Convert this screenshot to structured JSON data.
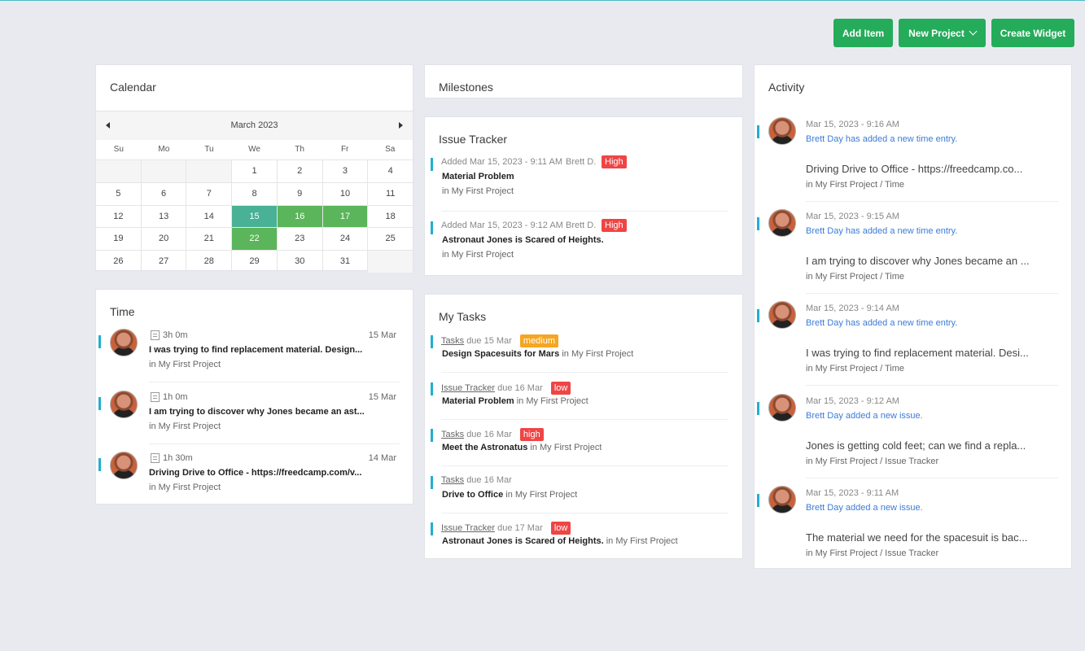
{
  "toolbar": {
    "add_item": "Add Item",
    "new_project": "New Project",
    "create_widget": "Create Widget"
  },
  "calendar": {
    "title": "Calendar",
    "month": "March 2023",
    "weekdays": [
      "Su",
      "Mo",
      "Tu",
      "We",
      "Th",
      "Fr",
      "Sa"
    ],
    "weeks": [
      [
        "",
        "",
        "",
        "1",
        "2",
        "3",
        "4"
      ],
      [
        "5",
        "6",
        "7",
        "8",
        "9",
        "10",
        "11"
      ],
      [
        "12",
        "13",
        "14",
        "15",
        "16",
        "17",
        "18"
      ],
      [
        "19",
        "20",
        "21",
        "22",
        "23",
        "24",
        "25"
      ],
      [
        "26",
        "27",
        "28",
        "29",
        "30",
        "31",
        ""
      ]
    ],
    "today": "15",
    "event_days": [
      "16",
      "17",
      "22"
    ]
  },
  "time": {
    "title": "Time",
    "entries": [
      {
        "duration": "3h 0m",
        "date": "15 Mar",
        "text": "I was trying to find replacement material. Design...",
        "project": "in My First Project"
      },
      {
        "duration": "1h 0m",
        "date": "15 Mar",
        "text": "I am trying to discover why Jones became an ast...",
        "project": "in My First Project"
      },
      {
        "duration": "1h 30m",
        "date": "14 Mar",
        "text": "Driving Drive to Office - https://freedcamp.com/v...",
        "project": "in My First Project"
      }
    ]
  },
  "milestones": {
    "title": "Milestones"
  },
  "issue_tracker": {
    "title": "Issue Tracker",
    "issues": [
      {
        "meta": "Added Mar 15, 2023 - 9:11 AM",
        "author": "Brett D.",
        "priority": "High",
        "title": "Material Problem",
        "project": "in My First Project"
      },
      {
        "meta": "Added Mar 15, 2023 - 9:12 AM",
        "author": "Brett D.",
        "priority": "High",
        "title": "Astronaut Jones is Scared of Heights.",
        "project": "in My First Project"
      }
    ]
  },
  "tasks": {
    "title": "My Tasks",
    "items": [
      {
        "app": "Tasks",
        "due": "due 15 Mar",
        "priority": "medium",
        "title": "Design Spacesuits for Mars",
        "project": "in My First Project"
      },
      {
        "app": "Issue Tracker",
        "due": "due 16 Mar",
        "priority": "low",
        "title": "Material Problem",
        "project": "in My First Project"
      },
      {
        "app": "Tasks",
        "due": "due 16 Mar",
        "priority": "high",
        "title": "Meet the Astronatus",
        "project": "in My First Project"
      },
      {
        "app": "Tasks",
        "due": "due 16 Mar",
        "priority": "",
        "title": "Drive to Office",
        "project": "in My First Project"
      },
      {
        "app": "Issue Tracker",
        "due": "due 17 Mar",
        "priority": "low",
        "title": "Astronaut Jones is Scared of Heights.",
        "project": "in My First Project"
      }
    ]
  },
  "activity": {
    "title": "Activity",
    "items": [
      {
        "time": "Mar 15, 2023 - 9:16 AM",
        "action": "Brett Day has added a new time entry.",
        "text": "Driving Drive to Office - https://freedcamp.co...",
        "path": "in My First Project / Time"
      },
      {
        "time": "Mar 15, 2023 - 9:15 AM",
        "action": "Brett Day has added a new time entry.",
        "text": "I am trying to discover why Jones became an ...",
        "path": "in My First Project / Time"
      },
      {
        "time": "Mar 15, 2023 - 9:14 AM",
        "action": "Brett Day has added a new time entry.",
        "text": "I was trying to find replacement material. Desi...",
        "path": "in My First Project / Time"
      },
      {
        "time": "Mar 15, 2023 - 9:12 AM",
        "action": "Brett Day added a new issue.",
        "text": "Jones is getting cold feet; can we find a repla...",
        "path": "in My First Project / Issue Tracker"
      },
      {
        "time": "Mar 15, 2023 - 9:11 AM",
        "action": "Brett Day added a new issue.",
        "text": "The material we need for the spacesuit is bac...",
        "path": "in My First Project / Issue Tracker"
      }
    ]
  },
  "colors": {
    "accent_green": "#25ac5a",
    "today": "#48b196",
    "event": "#5bb55a",
    "entry_bar": "#22aed1",
    "badge_high": "#ef4545",
    "badge_medium": "#f5a623",
    "activity_link": "#3c7cd6"
  }
}
